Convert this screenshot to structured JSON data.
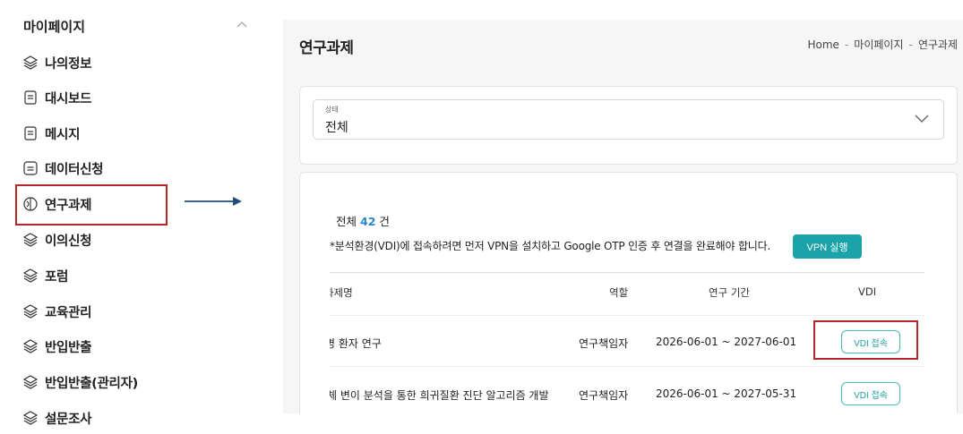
{
  "sidebar": {
    "header": "마이페이지",
    "items": [
      {
        "label": "나의정보",
        "icon": "layers-icon"
      },
      {
        "label": "대시보드",
        "icon": "document-icon"
      },
      {
        "label": "메시지",
        "icon": "document-icon"
      },
      {
        "label": "데이터신청",
        "icon": "form-icon"
      },
      {
        "label": "연구과제",
        "icon": "research-icon"
      },
      {
        "label": "이의신청",
        "icon": "layers-icon"
      },
      {
        "label": "포럼",
        "icon": "layers-icon"
      },
      {
        "label": "교육관리",
        "icon": "layers-icon"
      },
      {
        "label": "반입반출",
        "icon": "layers-icon"
      },
      {
        "label": "반입반출(관리자)",
        "icon": "layers-icon"
      },
      {
        "label": "설문조사",
        "icon": "layers-icon"
      }
    ]
  },
  "main": {
    "title": "연구과제",
    "breadcrumb": [
      "Home",
      "마이페이지",
      "연구과제"
    ],
    "filter": {
      "label": "상태",
      "value": "전체"
    },
    "count": {
      "prefix": "전체",
      "value": "42",
      "suffix": "건"
    },
    "notice": "*분석환경(VDI)에 접속하려면 먼저 VPN을 설치하고 Google OTP 인증 후 연결을 완료해야 합니다.",
    "vpn_button": "VPN 실행",
    "table": {
      "headers": [
        "과제명",
        "역할",
        "연구 기간",
        "VDI"
      ],
      "rows": [
        {
          "title": "병 환자 연구",
          "role": "연구책임자",
          "period": "2026-06-01 ~ 2027-06-01",
          "vdi": "VDI 접속"
        },
        {
          "title": "체 변이 분석을 통한 희귀질환 진단 알고리즘 개발",
          "role": "연구책임자",
          "period": "2026-06-01 ~ 2027-05-31",
          "vdi": "VDI 접속"
        }
      ]
    }
  },
  "colors": {
    "accent": "#1aa3a8",
    "highlight": "#b3262b",
    "count": "#2a88c9",
    "arrow": "#1f4e79"
  }
}
